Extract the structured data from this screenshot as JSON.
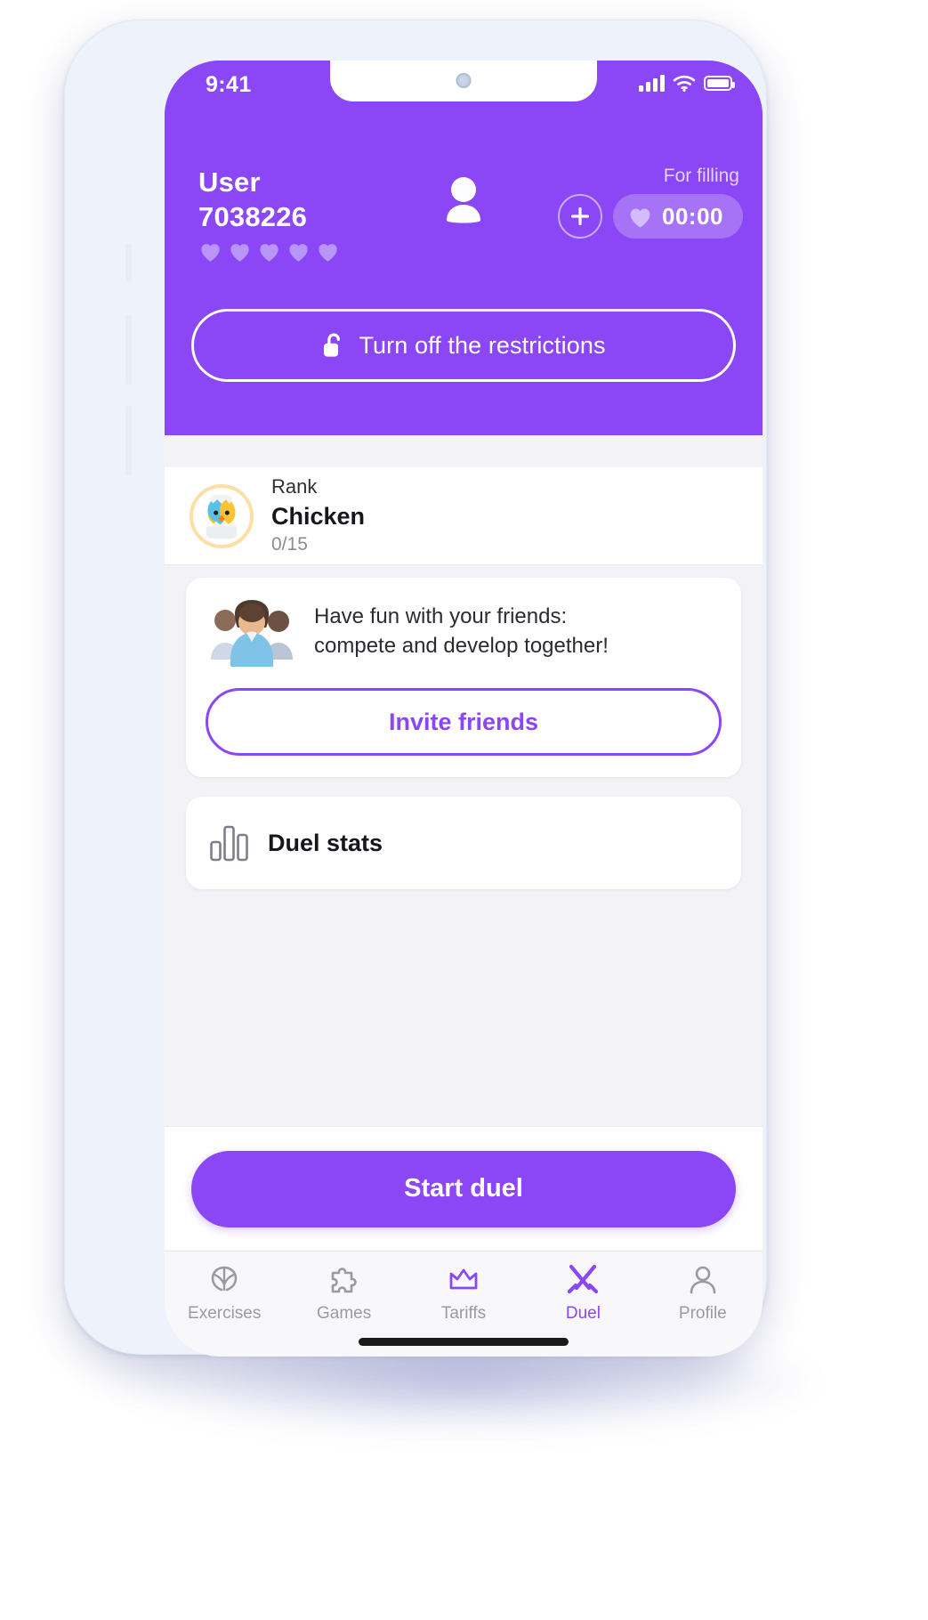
{
  "status_bar": {
    "time": "9:41",
    "icons": [
      "cellular-signal-icon",
      "wifi-icon",
      "battery-icon"
    ]
  },
  "colors": {
    "brand_purple": "#8b47f5",
    "header_bg": "#8b47f5",
    "screen_bg": "#f3f2f7",
    "card_bg": "#ffffff",
    "muted_text": "#8b8b95",
    "active_tab": "#8b47f5",
    "inactive_tab": "#9a9aa4",
    "rank_ring": "#fbdfa5"
  },
  "header": {
    "user_label": "User",
    "user_id": "7038226",
    "lives_total": 5,
    "lives_filled": 5,
    "avatar_icon": "person-icon",
    "for_filling_label": "For filling",
    "add_button_icon": "plus-icon",
    "timer_heart_icon": "heart-icon",
    "timer_value": "00:00",
    "restrictions_button": {
      "label": "Turn off the restrictions",
      "icon": "unlock-icon"
    }
  },
  "rank": {
    "label": "Rank",
    "value": "Chicken",
    "progress": "0/15",
    "avatar_icon": "hatching-chick-icon"
  },
  "friends_card": {
    "illustration_icon": "group-of-friends-icon",
    "text_line1": "Have fun with your friends:",
    "text_line2": "compete and develop together!",
    "invite_button_label": "Invite friends"
  },
  "duel_stats": {
    "label": "Duel stats",
    "icon": "bar-chart-icon"
  },
  "footer": {
    "start_duel_label": "Start duel"
  },
  "tabbar": {
    "items": [
      {
        "label": "Exercises",
        "icon": "brain-icon",
        "active": false
      },
      {
        "label": "Games",
        "icon": "puzzle-icon",
        "active": false
      },
      {
        "label": "Tariffs",
        "icon": "crown-icon",
        "active": false
      },
      {
        "label": "Duel",
        "icon": "swords-icon",
        "active": true
      },
      {
        "label": "Profile",
        "icon": "person-outline-icon",
        "active": false
      }
    ]
  }
}
